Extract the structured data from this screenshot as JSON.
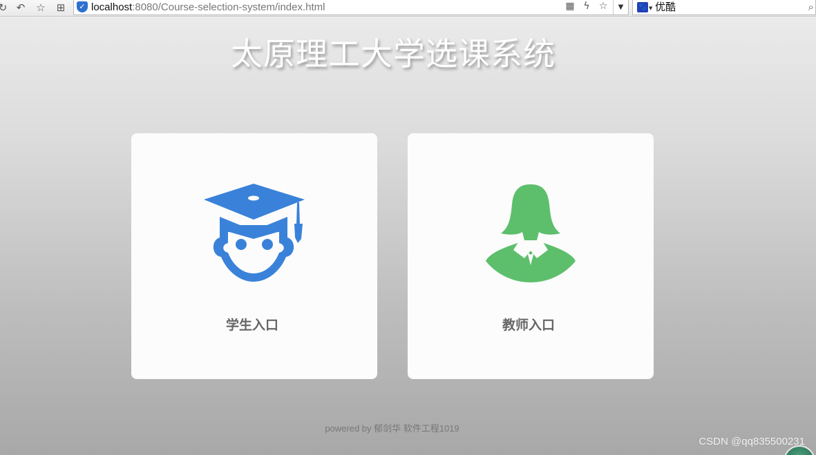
{
  "browser": {
    "url_host": "localhost",
    "url_path": ":8080/Course-selection-system/index.html",
    "search_value": "优酷",
    "icons": [
      "reload-icon",
      "back-icon",
      "star-icon",
      "apps-icon",
      "shield-icon",
      "qr-icon",
      "lightning-icon",
      "bookmark-star-icon",
      "dropdown-icon",
      "search-icon"
    ]
  },
  "page": {
    "title": "太原理工大学选课系统",
    "cards": [
      {
        "label": "学生入口",
        "icon": "student-graduate-icon",
        "color": "#3a82d9"
      },
      {
        "label": "教师入口",
        "icon": "teacher-female-icon",
        "color": "#5dbf6c"
      }
    ],
    "footer": "powered by 郁剑华 软件工程1019",
    "watermark": "CSDN @qq835500231"
  }
}
